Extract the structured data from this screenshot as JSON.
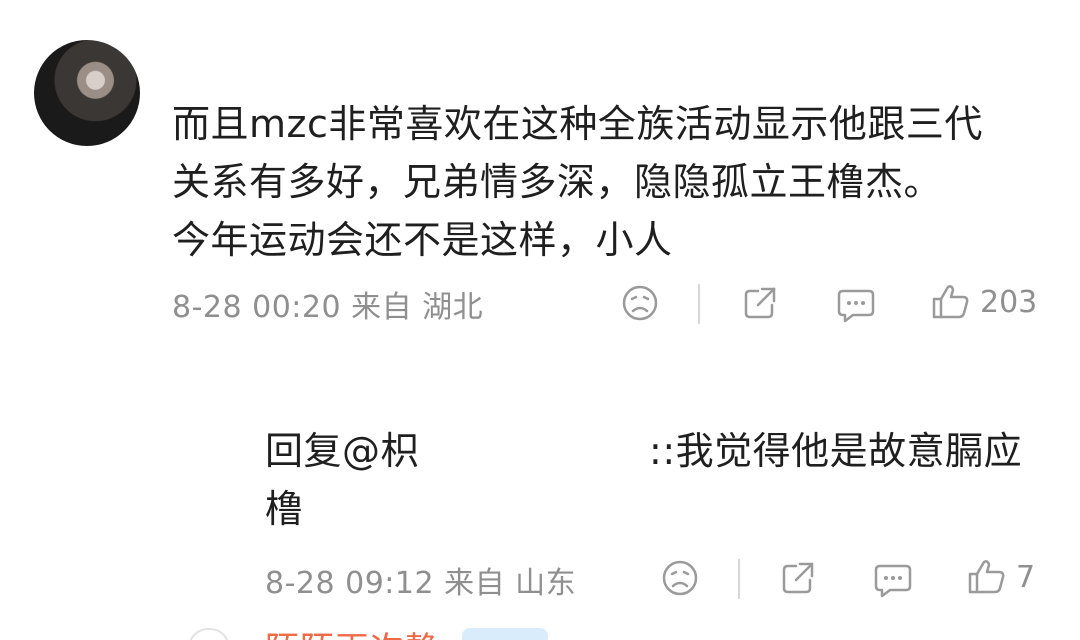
{
  "comment": {
    "text": "而且mzc非常喜欢在这种全族活动显示他跟三代\n关系有多好，兄弟情多深，隐隐孤立王橹杰。\n今年运动会还不是这样，小人",
    "meta": "8-28 00:20 来自 湖北",
    "like_count": "203"
  },
  "reply": {
    "prefix": "回复@枳",
    "body": "::我觉得他是故意膈应\n橹",
    "meta": "8-28 09:12 来自 山东",
    "like_count": "7"
  },
  "next_comment": {
    "name": "陌陌再次静"
  },
  "icons": {
    "dislike": "sad-face-icon",
    "share": "share-icon",
    "comment": "comment-icon",
    "like": "thumb-up-icon"
  },
  "colors": {
    "text": "#1f1f1f",
    "meta": "#8f8f8f",
    "next_name": "#f06a45"
  }
}
